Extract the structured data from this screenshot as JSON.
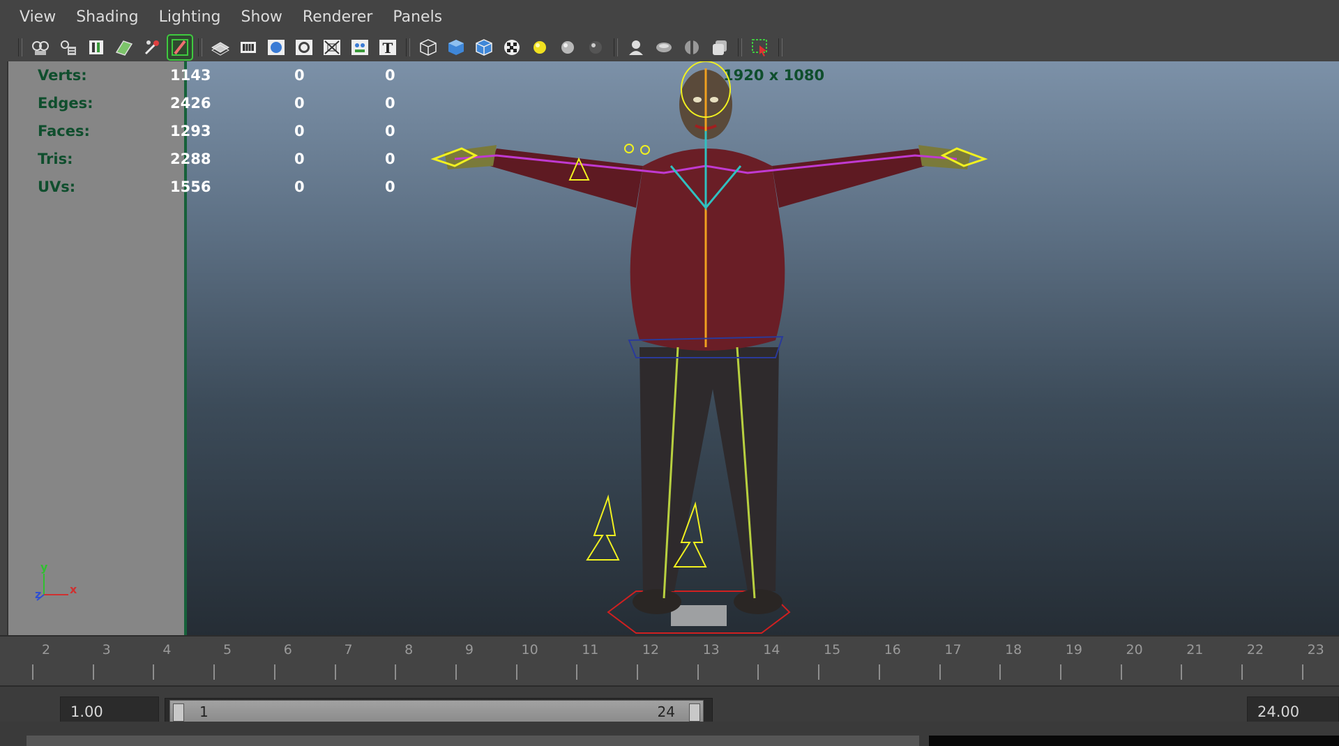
{
  "menu": [
    "View",
    "Shading",
    "Lighting",
    "Show",
    "Renderer",
    "Panels"
  ],
  "toolbar": {
    "icons": [
      "select-camera-icon",
      "camera-attributes-icon",
      "bookmarks-icon",
      "image-plane-icon",
      "2d-pan-zoom-icon",
      "grease-pencil-icon",
      "grid-icon",
      "film-gate-icon",
      "resolution-gate-icon",
      "gate-mask-icon",
      "field-chart-icon",
      "safe-action-icon",
      "safe-title-icon",
      "wireframe-icon",
      "smooth-shade-icon",
      "wireframe-on-shaded-icon",
      "textured-icon",
      "use-all-lights-icon",
      "shadows-icon",
      "screen-space-ao-icon",
      "motion-blur-icon",
      "multisample-aa-icon",
      "depth-of-field-icon",
      "xray-icon",
      "xray-joints-icon",
      "isolate-select-icon"
    ],
    "active_icon": "grease-pencil-icon"
  },
  "hud": {
    "rows": [
      {
        "label": "Verts:",
        "v1": "1143",
        "v2": "0",
        "v3": "0"
      },
      {
        "label": "Edges:",
        "v1": "2426",
        "v2": "0",
        "v3": "0"
      },
      {
        "label": "Faces:",
        "v1": "1293",
        "v2": "0",
        "v3": "0"
      },
      {
        "label": "Tris:",
        "v1": "2288",
        "v2": "0",
        "v3": "0"
      },
      {
        "label": "UVs:",
        "v1": "1556",
        "v2": "0",
        "v3": "0"
      }
    ],
    "resolution": "1920 x 1080"
  },
  "axis": {
    "y": "y",
    "z": "z",
    "x": "x"
  },
  "timeline": {
    "labels": [
      "2",
      "3",
      "4",
      "5",
      "6",
      "7",
      "8",
      "9",
      "10",
      "11",
      "12",
      "13",
      "14",
      "15",
      "16",
      "17",
      "18",
      "19",
      "20",
      "21",
      "22",
      "23"
    ]
  },
  "range": {
    "start_time": "1.00",
    "range_start": "1",
    "range_end": "24",
    "end_time": "24.00"
  },
  "colors": {
    "hud_label": "#0f4e2d",
    "active_tool": "#3fc93f",
    "panel_border": "#16613a"
  }
}
